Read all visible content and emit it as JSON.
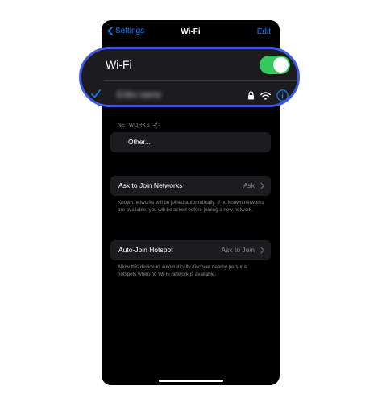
{
  "navbar": {
    "back_label": "Settings",
    "title": "Wi-Fi",
    "edit_label": "Edit"
  },
  "wifi_section": {
    "label": "Wi-Fi",
    "enabled": true,
    "connected_network": "Eriks name"
  },
  "networks_section": {
    "header": "NETWORKS",
    "other_label": "Other..."
  },
  "ask_to_join": {
    "label": "Ask to Join Networks",
    "value": "Ask",
    "footnote": "Known networks will be joined automatically. If no known networks are available, you will be asked before joining a new network."
  },
  "auto_join_hotspot": {
    "label": "Auto-Join Hotspot",
    "value": "Ask to Join",
    "footnote": "Allow this device to automatically discover nearby personal hotspots when no Wi-Fi network is available."
  },
  "colors": {
    "accent": "#0a84ff",
    "toggle_on": "#34c759",
    "highlight_border": "#3f5be3",
    "cell_bg": "#1c1c1e"
  },
  "icons": [
    "chevron-left-icon",
    "spinner-icon",
    "chevron-right-icon",
    "checkmark-icon",
    "lock-icon",
    "wifi-icon",
    "info-icon"
  ]
}
